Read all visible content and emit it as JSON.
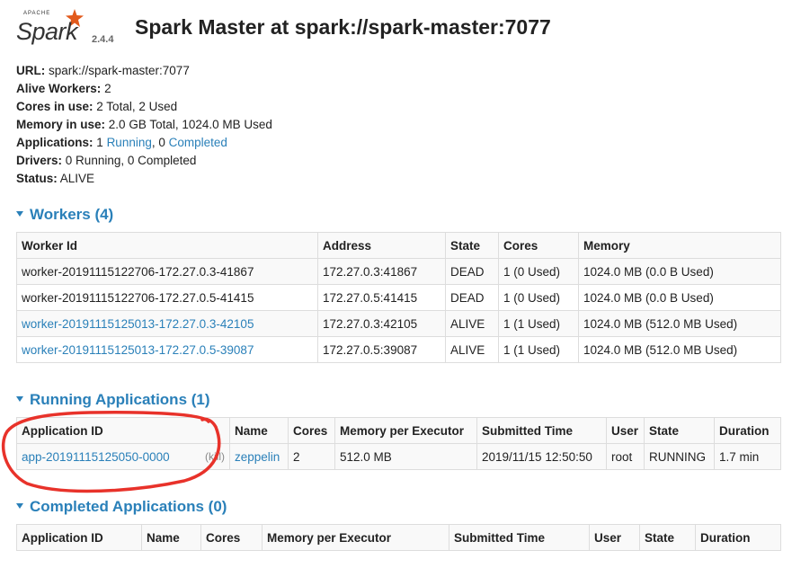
{
  "header": {
    "logo_apache": "APACHE",
    "logo_spark": "Spark",
    "version": "2.4.4",
    "title": "Spark Master at spark://spark-master:7077"
  },
  "summary": {
    "url_label": "URL:",
    "url": "spark://spark-master:7077",
    "workers_label": "Alive Workers:",
    "workers": "2",
    "cores_label": "Cores in use:",
    "cores": "2 Total, 2 Used",
    "memory_label": "Memory in use:",
    "memory": "2.0 GB Total, 1024.0 MB Used",
    "apps_label": "Applications:",
    "apps_running_count": "1",
    "apps_running_link": "Running",
    "apps_sep": ", 0",
    "apps_completed_link": "Completed",
    "drivers_label": "Drivers:",
    "drivers": "0 Running, 0 Completed",
    "status_label": "Status:",
    "status": "ALIVE"
  },
  "workers": {
    "title": "Workers (4)",
    "columns": [
      "Worker Id",
      "Address",
      "State",
      "Cores",
      "Memory"
    ],
    "rows": [
      [
        "worker-20191115122706-172.27.0.3-41867",
        "172.27.0.3:41867",
        "DEAD",
        "1 (0 Used)",
        "1024.0 MB (0.0 B Used)"
      ],
      [
        "worker-20191115122706-172.27.0.5-41415",
        "172.27.0.5:41415",
        "DEAD",
        "1 (0 Used)",
        "1024.0 MB (0.0 B Used)"
      ],
      [
        "worker-20191115125013-172.27.0.3-42105",
        "172.27.0.3:42105",
        "ALIVE",
        "1 (1 Used)",
        "1024.0 MB (512.0 MB Used)"
      ],
      [
        "worker-20191115125013-172.27.0.5-39087",
        "172.27.0.5:39087",
        "ALIVE",
        "1 (1 Used)",
        "1024.0 MB (512.0 MB Used)"
      ]
    ]
  },
  "running": {
    "title": "Running Applications (1)",
    "columns": [
      "Application ID",
      "Name",
      "Cores",
      "Memory per Executor",
      "Submitted Time",
      "User",
      "State",
      "Duration"
    ],
    "rows": [
      {
        "id": "app-20191115125050-0000",
        "kill": "(kill)",
        "name": "zeppelin",
        "cores": "2",
        "memory": "512.0 MB",
        "submitted": "2019/11/15 12:50:50",
        "user": "root",
        "state": "RUNNING",
        "duration": "1.7 min"
      }
    ]
  },
  "completed": {
    "title": "Completed Applications (0)",
    "columns": [
      "Application ID",
      "Name",
      "Cores",
      "Memory per Executor",
      "Submitted Time",
      "User",
      "State",
      "Duration"
    ]
  },
  "colors": {
    "link": "#2a80b9",
    "annotation": "#e8322a",
    "logo_star": "#e25a1c"
  }
}
